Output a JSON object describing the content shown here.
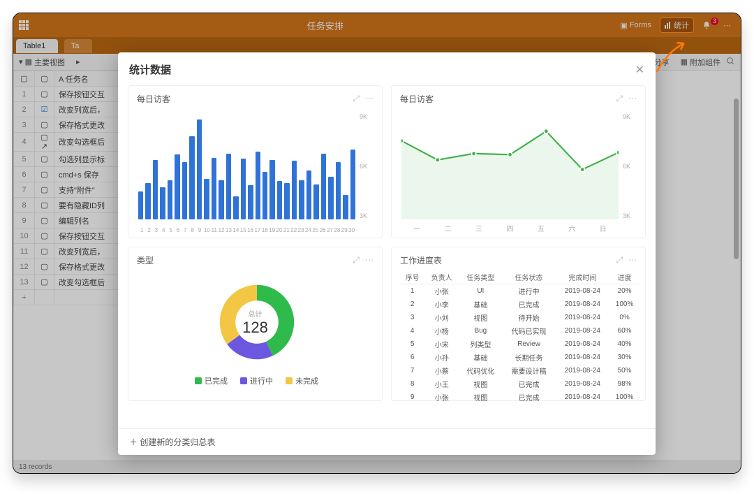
{
  "topbar": {
    "title": "任务安排",
    "forms": "Forms",
    "stats": "统计",
    "bell_count": "3"
  },
  "tabs": [
    "Table1",
    "Ta"
  ],
  "toolbar": {
    "view": "主要视图",
    "share": "分享",
    "addon": "附加组件"
  },
  "grid": {
    "head": {
      "name": "任务名"
    },
    "rows": [
      {
        "n": "1",
        "t": "保存按钮交互"
      },
      {
        "n": "2",
        "t": "改变列宽后，"
      },
      {
        "n": "3",
        "t": "保存格式更改"
      },
      {
        "n": "4",
        "t": "改变勾选框后"
      },
      {
        "n": "5",
        "t": "勾选列显示标"
      },
      {
        "n": "6",
        "t": "cmd+s 保存"
      },
      {
        "n": "7",
        "t": "支持\"附件\""
      },
      {
        "n": "8",
        "t": "要有隐藏ID列"
      },
      {
        "n": "9",
        "t": "编辑列名"
      },
      {
        "n": "10",
        "t": "保存按钮交互"
      },
      {
        "n": "11",
        "t": "改变列宽后，"
      },
      {
        "n": "12",
        "t": "保存格式更改"
      },
      {
        "n": "13",
        "t": "改变勾选框后"
      }
    ],
    "footer": "13 records"
  },
  "modal_title": "统计数据",
  "create_button": "创建新的分类归总表",
  "card_titles": {
    "bar": "每日访客",
    "line": "每日访客",
    "donut": "类型",
    "table": "工作进度表"
  },
  "donut": {
    "center_label": "总计",
    "center_value": "128",
    "legend": [
      {
        "c": "#2fbb4b",
        "t": "已完成"
      },
      {
        "c": "#6b57e0",
        "t": "进行中"
      },
      {
        "c": "#f3c744",
        "t": "未完成"
      }
    ]
  },
  "progress": {
    "head": [
      "序号",
      "负责人",
      "任务类型",
      "任务状态",
      "完成时间",
      "进度"
    ],
    "rows": [
      [
        "1",
        "小张",
        "UI",
        "进行中",
        "2019-08-24",
        "20%"
      ],
      [
        "2",
        "小李",
        "基础",
        "已完成",
        "2019-08-24",
        "100%"
      ],
      [
        "3",
        "小刘",
        "视图",
        "待开始",
        "2019-08-24",
        "0%"
      ],
      [
        "4",
        "小杨",
        "Bug",
        "代码已实现",
        "2019-08-24",
        "60%"
      ],
      [
        "5",
        "小宋",
        "列类型",
        "Review",
        "2019-08-24",
        "40%"
      ],
      [
        "6",
        "小孙",
        "基础",
        "长期任务",
        "2019-08-24",
        "30%"
      ],
      [
        "7",
        "小蔡",
        "代码优化",
        "需要设计稿",
        "2019-08-24",
        "50%"
      ],
      [
        "8",
        "小王",
        "视图",
        "已完成",
        "2019-08-24",
        "98%"
      ],
      [
        "9",
        "小张",
        "视图",
        "已完成",
        "2019-08-24",
        "100%"
      ]
    ]
  },
  "chart_data": [
    {
      "type": "bar",
      "title": "每日访客",
      "ylim": [
        0,
        10000
      ],
      "yticks": [
        "9K",
        "6K",
        "3K"
      ],
      "categories": [
        "1",
        "2",
        "3",
        "4",
        "5",
        "6",
        "7",
        "8",
        "9",
        "10",
        "11",
        "12",
        "13",
        "14",
        "15",
        "16",
        "17",
        "18",
        "19",
        "20",
        "21",
        "22",
        "23",
        "24",
        "25",
        "26",
        "27",
        "28",
        "29",
        "30"
      ],
      "values": [
        2600,
        3400,
        5600,
        3000,
        3700,
        6100,
        5400,
        7800,
        9400,
        3800,
        5800,
        3700,
        6200,
        2200,
        5700,
        3200,
        6400,
        4500,
        5600,
        3600,
        3400,
        5500,
        3700,
        4600,
        3300,
        6200,
        4000,
        5400,
        2300,
        6600
      ]
    },
    {
      "type": "line",
      "title": "每日访客",
      "ylim": [
        0,
        10000
      ],
      "yticks": [
        "9K",
        "6K",
        "3K"
      ],
      "categories": [
        "一",
        "二",
        "三",
        "四",
        "五",
        "六",
        "日"
      ],
      "values": [
        7400,
        5600,
        6200,
        6100,
        8300,
        4700,
        6300
      ]
    },
    {
      "type": "pie",
      "title": "类型",
      "total": 128,
      "series": [
        {
          "name": "已完成",
          "value": 55,
          "color": "#2fbb4b"
        },
        {
          "name": "进行中",
          "value": 28,
          "color": "#6b57e0"
        },
        {
          "name": "未完成",
          "value": 45,
          "color": "#f3c744"
        }
      ]
    },
    {
      "type": "table",
      "title": "工作进度表"
    }
  ]
}
